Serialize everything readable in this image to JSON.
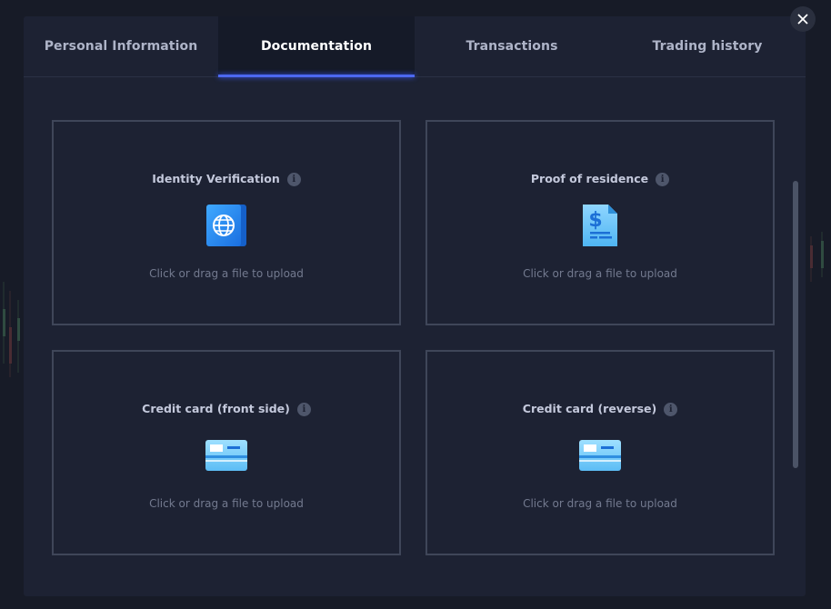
{
  "tabs": [
    {
      "label": "Personal Information",
      "active": false
    },
    {
      "label": "Documentation",
      "active": true
    },
    {
      "label": "Transactions",
      "active": false
    },
    {
      "label": "Trading history",
      "active": false
    }
  ],
  "close_icon": "close-icon",
  "accent_color": "#4c68f0",
  "cards": [
    {
      "title": "Identity Verification",
      "icon": "passport-icon",
      "hint": "Click or drag a file to upload"
    },
    {
      "title": "Proof of residence",
      "icon": "bill-document-icon",
      "hint": "Click or drag a file to upload"
    },
    {
      "title": "Credit card (front side)",
      "icon": "credit-card-front-icon",
      "hint": "Click or drag a file to upload"
    },
    {
      "title": "Credit card (reverse)",
      "icon": "credit-card-reverse-icon",
      "hint": "Click or drag a file to upload"
    }
  ]
}
